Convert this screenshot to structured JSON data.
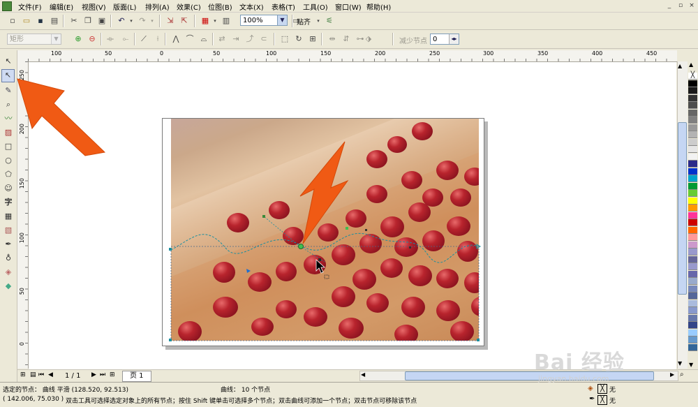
{
  "menu": {
    "items": [
      "文件(F)",
      "编辑(E)",
      "视图(V)",
      "版面(L)",
      "排列(A)",
      "效果(C)",
      "位图(B)",
      "文本(X)",
      "表格(T)",
      "工具(O)",
      "窗口(W)",
      "帮助(H)"
    ],
    "window_buttons": [
      "_",
      "▫",
      "×"
    ]
  },
  "standard_toolbar": {
    "zoom_value": "100%",
    "snap_label": "贴齐"
  },
  "property_bar": {
    "shape_combo": "矩形",
    "reduce_nodes_label": "减少节点",
    "curve_smoothness_value": "0"
  },
  "rulers": {
    "horizontal_ticks": [
      "100",
      "50",
      "0",
      "50",
      "100",
      "150",
      "200",
      "250",
      "300",
      "350",
      "400",
      "450"
    ],
    "vertical_ticks": [
      "250",
      "200",
      "150",
      "100",
      "50",
      "0"
    ]
  },
  "page_nav": {
    "page_count": "1 / 1",
    "page_tab": "页 1"
  },
  "status_bar": {
    "selected_nodes": "选定的节点： 曲线 平滑 (128.520, 92.513)",
    "curve_info": "曲线： 10 个节点",
    "coords": "( 142.006, 75.030 )",
    "hint": "双击工具可选择选定对象上的所有节点；按住 Shift 键单击可选择多个节点；双击曲线可添加一个节点；双击节点可移除该节点",
    "fill_label": "无",
    "outline_label": "无"
  },
  "palette_colors": [
    "#ffffff",
    "#000000",
    "#1a1a1a",
    "#333333",
    "#4d4d4d",
    "#666666",
    "#808080",
    "#999999",
    "#b3b3b3",
    "#cccccc",
    "#e6e6e6",
    "#f2f2f2",
    "#2b2b8a",
    "#0033cc",
    "#00a3cc",
    "#009933",
    "#66cc33",
    "#ffff00",
    "#ff9900",
    "#ff3399",
    "#cc0000",
    "#ff6600",
    "#ff9999",
    "#cc99cc",
    "#9999cc",
    "#666699",
    "#9999cc",
    "#6666aa",
    "#99aacc",
    "#7788bb",
    "#556699",
    "#aabbdd",
    "#8899cc",
    "#6677aa",
    "#334488",
    "#99ccff",
    "#6699cc",
    "#336699"
  ],
  "watermark": {
    "brand": "Bai 经验",
    "url": "jingyan.baidu.com"
  },
  "colors": {
    "arrow": "#f05a14",
    "node_green": "#3fbf4f",
    "curve_blue": "#1a8fa0"
  }
}
